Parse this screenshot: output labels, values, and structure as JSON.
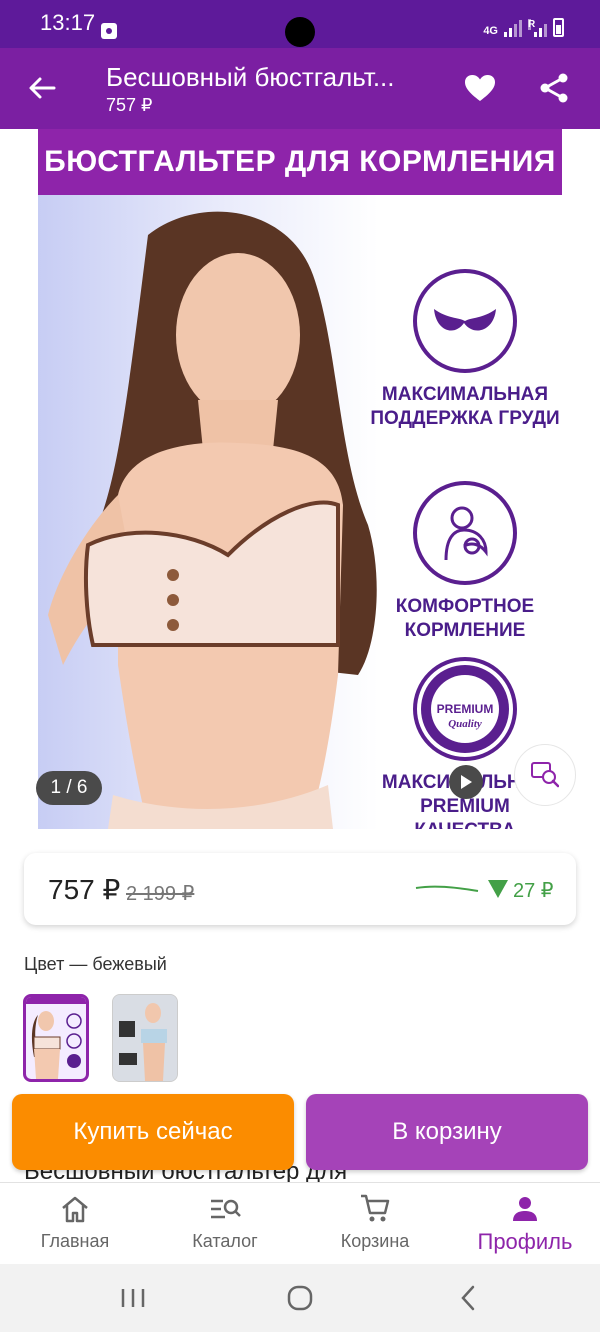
{
  "status_bar": {
    "time": "13:17",
    "network": "4G",
    "roaming": "R"
  },
  "app_bar": {
    "title": "Бесшовный бюстгальт...",
    "price": "757 ₽"
  },
  "product_image": {
    "banner": "БЮСТГАЛЬТЕР ДЛЯ КОРМЛЕНИЯ",
    "features": [
      "МАКСИМАЛЬНАЯ ПОДДЕРЖКА ГРУДИ",
      "КОМФОРТНОЕ КОРМЛЕНИЕ",
      "МАКСИМАЛЬНОЕ PREMIUM КАЧЕСТВА"
    ],
    "premium_badge_top": "PREMIUM",
    "premium_badge_bottom": "Quality",
    "counter": "1 / 6"
  },
  "price_card": {
    "current": "757 ₽",
    "old": "2 199 ₽",
    "diff": "27 ₽",
    "accent_color": "#43a047"
  },
  "color": {
    "label": "Цвет — бежевый",
    "variant_count": 2
  },
  "description_peek": "Бесшовный бюстгальтер для",
  "actions": {
    "buy_now": "Купить сейчас",
    "add_to_cart": "В корзину"
  },
  "bottom_nav": {
    "items": [
      {
        "label": "Главная",
        "icon": "home-icon"
      },
      {
        "label": "Каталог",
        "icon": "catalog-search-icon"
      },
      {
        "label": "Корзина",
        "icon": "cart-icon"
      },
      {
        "label": "Профиль",
        "icon": "profile-icon"
      }
    ],
    "active_index": 3
  },
  "colors": {
    "status_bar": "#5e1a9a",
    "app_bar": "#7b1fa2",
    "banner": "#8e24aa",
    "buy_button": "#fb8c00",
    "cart_button": "#a543b8"
  }
}
